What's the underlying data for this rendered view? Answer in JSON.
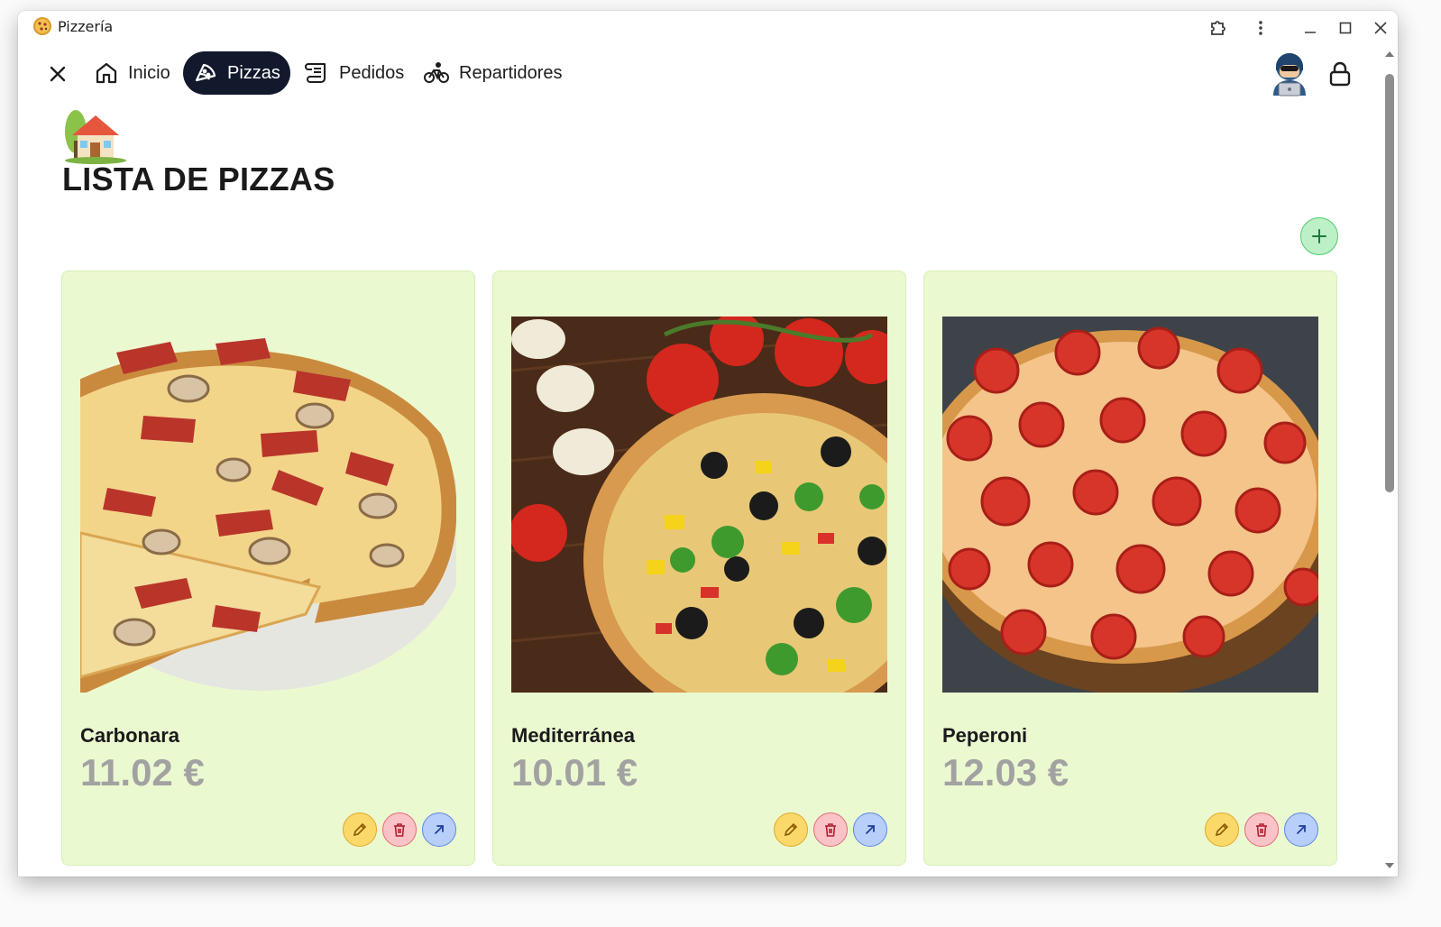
{
  "window": {
    "title": "Pizzería"
  },
  "nav": {
    "items": [
      {
        "label": "Inicio",
        "icon": "home-icon"
      },
      {
        "label": "Pizzas",
        "icon": "pizza-icon",
        "active": true
      },
      {
        "label": "Pedidos",
        "icon": "receipt-scroll-icon"
      },
      {
        "label": "Repartidores",
        "icon": "bicycle-icon"
      }
    ]
  },
  "page": {
    "title": "LISTA DE PIZZAS"
  },
  "pizzas": [
    {
      "name": "Carbonara",
      "price": "11.02 €"
    },
    {
      "name": "Mediterránea",
      "price": "10.01 €"
    },
    {
      "name": "Peperoni",
      "price": "12.03 €"
    }
  ],
  "colors": {
    "nav_active_bg": "#12192d",
    "card_bg": "#ebf9d0",
    "price_color": "#a2a2a2",
    "add_button": "#bdf0c7",
    "edit_button": "#fbd86a",
    "delete_button": "#fbc3c8",
    "open_button": "#b7cffa"
  }
}
